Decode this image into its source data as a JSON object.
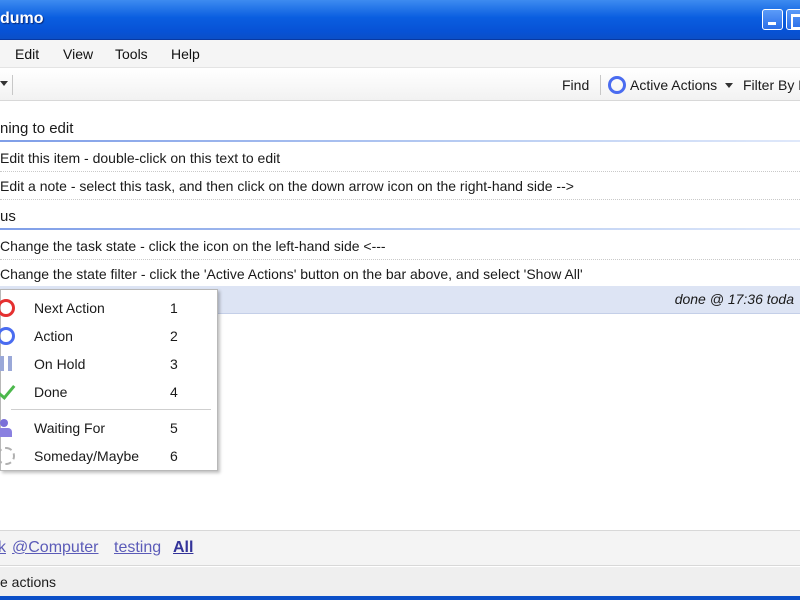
{
  "window": {
    "title": "dumo"
  },
  "menu": {
    "items": [
      "Edit",
      "View",
      "Tools",
      "Help"
    ]
  },
  "toolbar": {
    "find_label": "Find",
    "active_actions_label": "Active Actions",
    "filter_label": "Filter By D",
    "accent_color": "#4a6cf0"
  },
  "groups": [
    {
      "title": "ning to edit",
      "tasks": [
        "Edit this item - double-click on this text to edit",
        "Edit a note - select this task, and then click on the down arrow icon on the right-hand side -->"
      ]
    },
    {
      "title": "us",
      "tasks": [
        "Change the task state - click the icon on the left-hand side <---",
        "Change the state filter - click the 'Active Actions' button on the bar above, and select 'Show All'"
      ]
    }
  ],
  "selected_row": {
    "status": "done @ 17:36 toda"
  },
  "state_menu": {
    "items": [
      {
        "label": "Next Action",
        "key": "1",
        "icon": "next-action-icon",
        "color": "#e53030"
      },
      {
        "label": "Action",
        "key": "2",
        "icon": "action-icon",
        "color": "#4a6cf0"
      },
      {
        "label": "On Hold",
        "key": "3",
        "icon": "on-hold-icon",
        "color": "#9aa8d8"
      },
      {
        "label": "Done",
        "key": "4",
        "icon": "done-check-icon",
        "color": "#4cb84c"
      },
      {
        "label": "Waiting For",
        "key": "5",
        "icon": "waiting-for-person-icon",
        "color": "#7a70d8"
      },
      {
        "label": "Someday/Maybe",
        "key": "6",
        "icon": "someday-cloud-icon",
        "color": "#b0b0b0"
      }
    ]
  },
  "contexts": {
    "items": [
      "@Computer",
      "testing"
    ],
    "all_label": "All"
  },
  "status_bar": {
    "text": "e actions"
  }
}
